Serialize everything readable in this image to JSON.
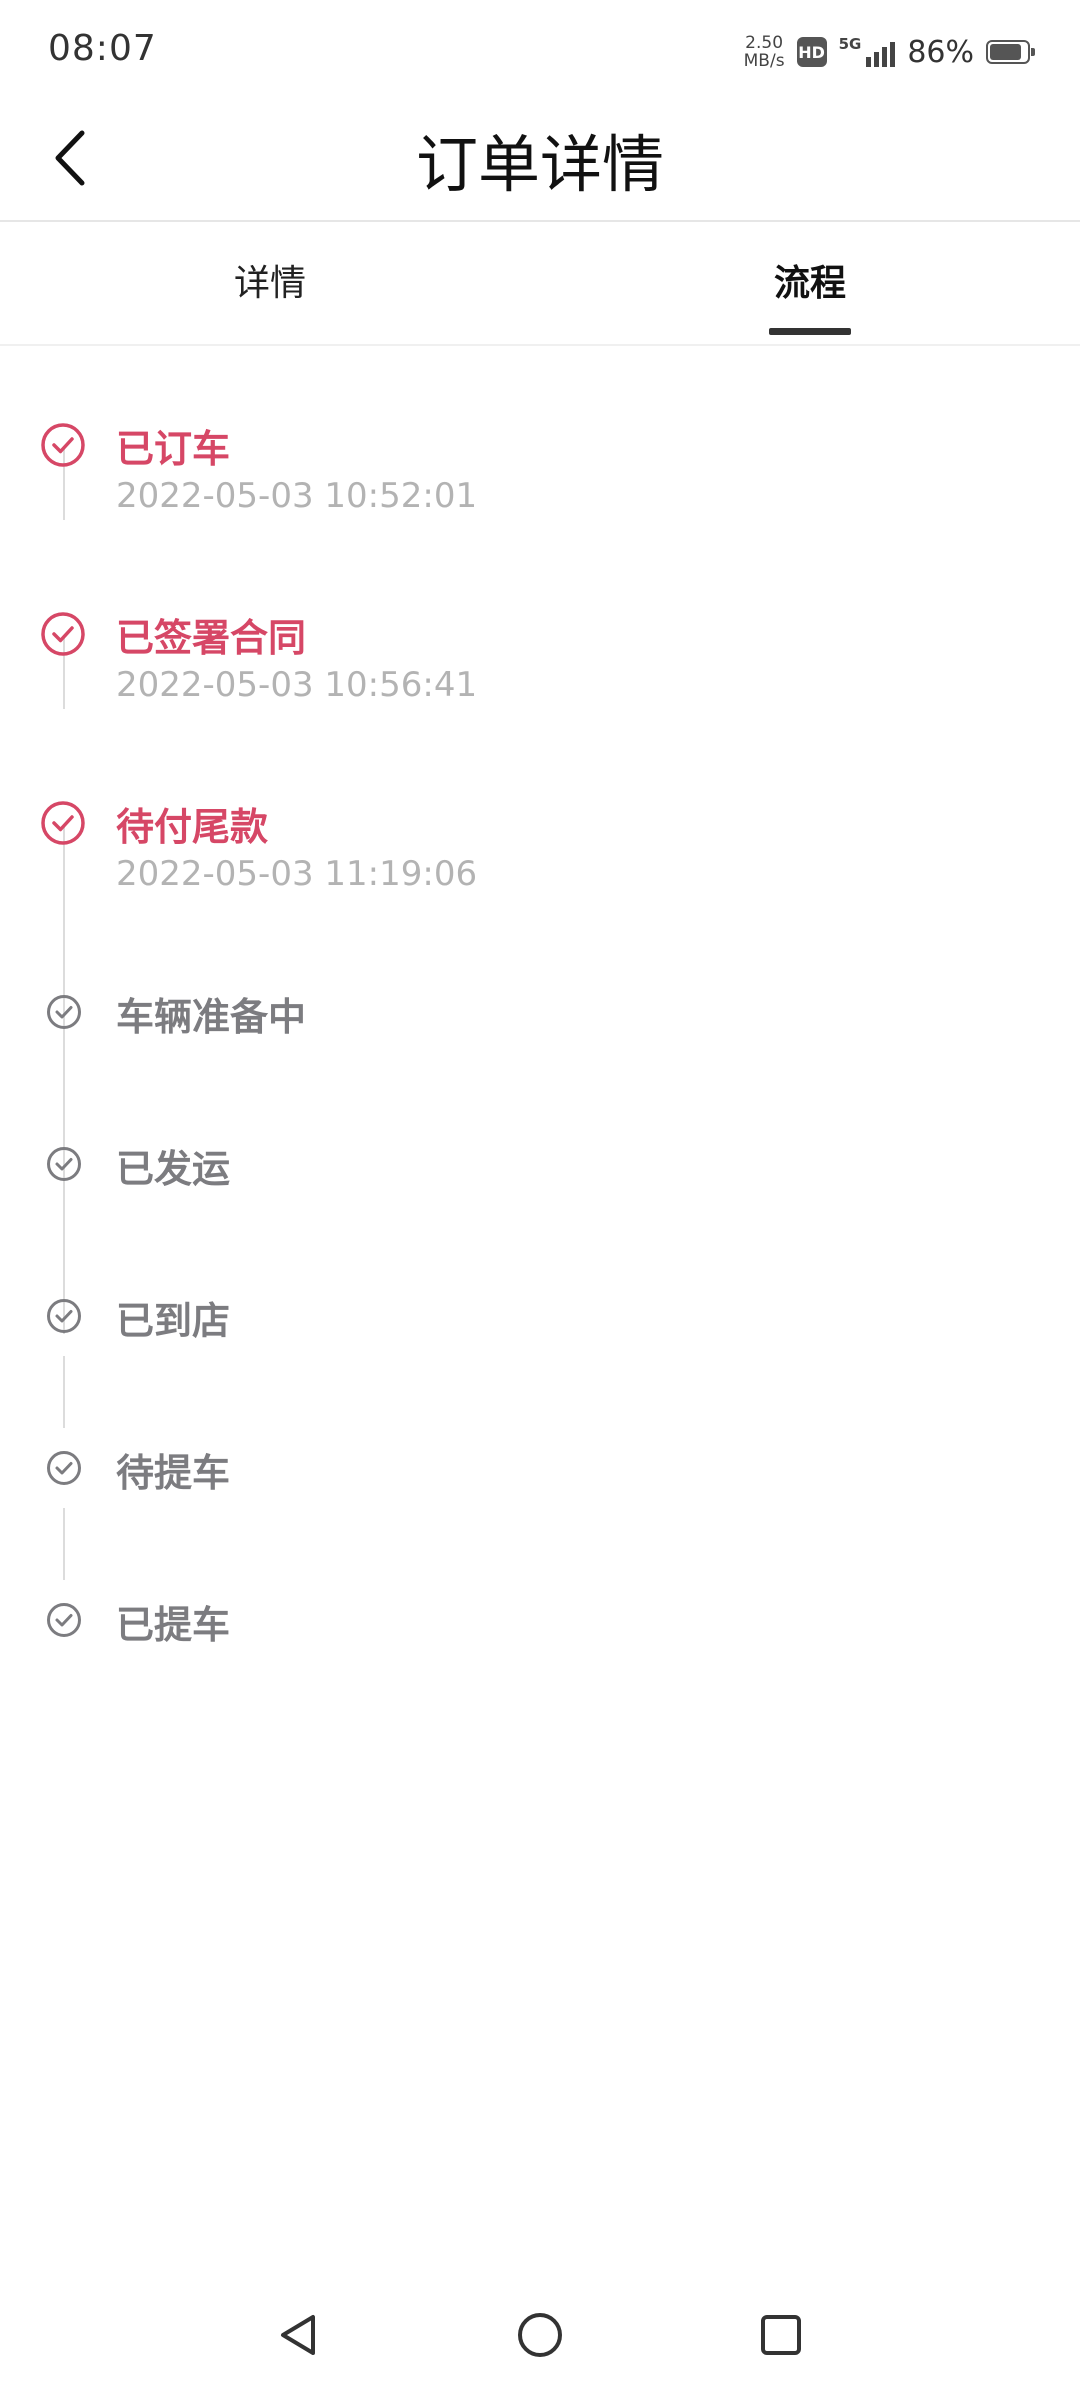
{
  "status_bar": {
    "time": "08:07",
    "net_speed_value": "2.50",
    "net_speed_unit": "MB/s",
    "hd_label": "HD",
    "signal_label": "5G",
    "battery_percent": "86%",
    "battery_level": 0.86
  },
  "header": {
    "title": "订单详情",
    "back_icon": "chevron-left-icon"
  },
  "tabs": [
    {
      "label": "详情",
      "active": false
    },
    {
      "label": "流程",
      "active": true
    }
  ],
  "timeline": {
    "colors": {
      "done": "#d64766",
      "pending": "#7c7c80",
      "time": "#b3b3b3",
      "line": "#dcdcdc"
    },
    "steps": [
      {
        "title": "已订车",
        "time": "2022-05-03 10:52:01",
        "status": "done"
      },
      {
        "title": "已签署合同",
        "time": "2022-05-03 10:56:41",
        "status": "done"
      },
      {
        "title": "待付尾款",
        "time": "2022-05-03 11:19:06",
        "status": "done"
      },
      {
        "title": "车辆准备中",
        "status": "pending"
      },
      {
        "title": "已发运",
        "status": "pending"
      },
      {
        "title": "已到店",
        "status": "pending"
      },
      {
        "title": "待提车",
        "status": "pending"
      },
      {
        "title": "已提车",
        "status": "pending"
      }
    ]
  },
  "nav_bar": {
    "back_icon": "triangle-back-icon",
    "home_icon": "circle-home-icon",
    "recents_icon": "square-recents-icon"
  }
}
